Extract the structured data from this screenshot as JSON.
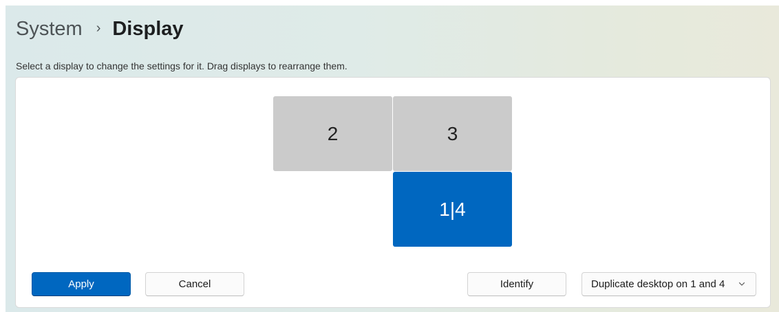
{
  "breadcrumb": {
    "parent": "System",
    "separator": "›",
    "current": "Display"
  },
  "instructions": "Select a display to change the settings for it. Drag displays to rearrange them.",
  "monitors": [
    {
      "label": "2",
      "selected": false
    },
    {
      "label": "3",
      "selected": false
    },
    {
      "label": "1|4",
      "selected": true
    }
  ],
  "buttons": {
    "apply": "Apply",
    "cancel": "Cancel",
    "identify": "Identify"
  },
  "multiple_displays": {
    "selected": "Duplicate desktop on 1 and 4",
    "icon": "chevron-down-icon"
  },
  "colors": {
    "accent": "#0067c0",
    "monitor_unselected": "#cbcbcb"
  }
}
